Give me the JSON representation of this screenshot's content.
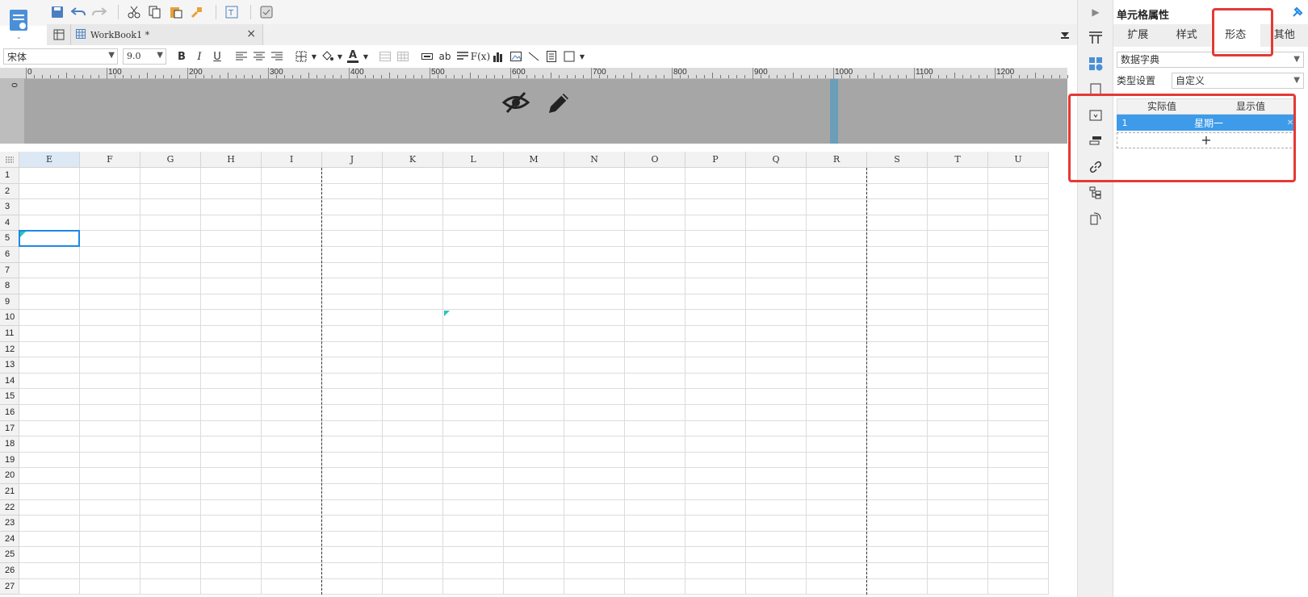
{
  "tab": {
    "title": "WorkBook1 *",
    "close": "×"
  },
  "format": {
    "font": "宋体",
    "size": "9.0",
    "bold": "B",
    "italic": "I",
    "underline": "U",
    "text_color_letter": "A",
    "ab": "ab",
    "fx": "F(x)"
  },
  "ruler": {
    "labels": [
      "0",
      "100",
      "200",
      "300",
      "400",
      "500",
      "600",
      "700",
      "800",
      "900",
      "1000",
      "1100",
      "1200"
    ],
    "v_label": "0"
  },
  "columns": [
    "E",
    "F",
    "G",
    "H",
    "I",
    "J",
    "K",
    "L",
    "M",
    "N",
    "O",
    "P",
    "Q",
    "R",
    "S",
    "T",
    "U"
  ],
  "rows": [
    "1",
    "2",
    "3",
    "4",
    "5",
    "6",
    "7",
    "8",
    "9",
    "10",
    "11",
    "12",
    "13",
    "14",
    "15",
    "16",
    "17",
    "18",
    "19",
    "20",
    "21",
    "22",
    "23",
    "24",
    "25",
    "26",
    "27"
  ],
  "panel": {
    "title": "单元格属性",
    "tabs": [
      "扩展",
      "样式",
      "形态",
      "其他"
    ],
    "active_tab": "形态",
    "widget_type": "数据字典",
    "type_label": "类型设置",
    "type_value": "自定义",
    "table": {
      "headers": [
        "实际值",
        "显示值"
      ],
      "rows": [
        {
          "index": "1",
          "value": "星期一"
        }
      ],
      "add": "+"
    }
  },
  "colors": {
    "accent": "#1e88e5",
    "highlight": "#e53935",
    "selected_row": "#3d9be9",
    "header_area": "#a6a6a6"
  }
}
